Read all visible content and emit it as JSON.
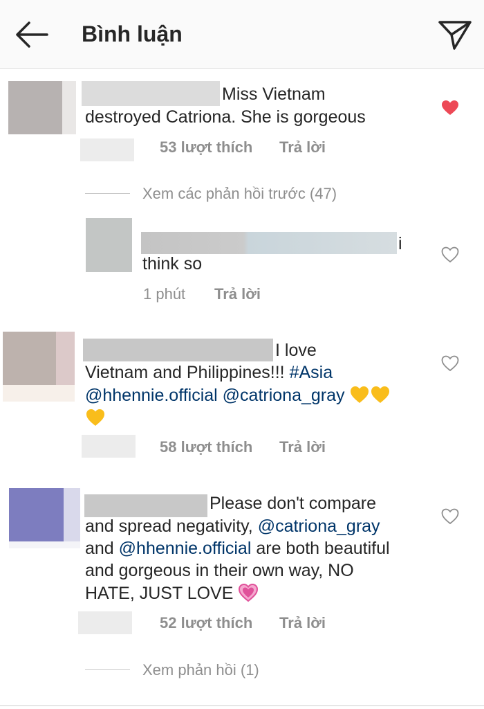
{
  "header": {
    "title": "Bình luận",
    "back_icon": "arrow-left-icon",
    "send_icon": "paper-plane-icon"
  },
  "colors": {
    "liked": "#ed4956",
    "mention": "#003569",
    "heart_emoji": "#f9bd1b",
    "pink_heart": "#e0519a"
  },
  "comments": [
    {
      "text_line1": "Miss Vietnam",
      "text_line2": "destroyed Catriona. She is gorgeous",
      "likes": "53 lượt thích",
      "reply": "Trả lời",
      "liked": true,
      "view_replies": "Xem các phản hồi trước (47)"
    },
    {
      "text_line1": "i",
      "text_line2": "think so",
      "time": "1 phút",
      "reply": "Trả lời"
    },
    {
      "text_line1": "I love",
      "text_line2a": "Vietnam and Philippines!!! ",
      "hashtag": "#Asia",
      "mention1": "@hhennie.official",
      "mention2": "@catriona_gray",
      "likes": "58 lượt thích",
      "reply": "Trả lời"
    },
    {
      "text_line1": "Please don't compare",
      "text_line2a": "and spread negativity, ",
      "mention1": "@catriona_gray",
      "text_line3a": "and ",
      "mention2": "@hhennie.official",
      "text_line3b": " are both beautiful",
      "text_line4": "and gorgeous in their own way, NO",
      "text_line5": "HATE, JUST LOVE ",
      "likes": "52 lượt thích",
      "reply": "Trả lời",
      "view_replies": "Xem phản hồi (1)"
    }
  ]
}
